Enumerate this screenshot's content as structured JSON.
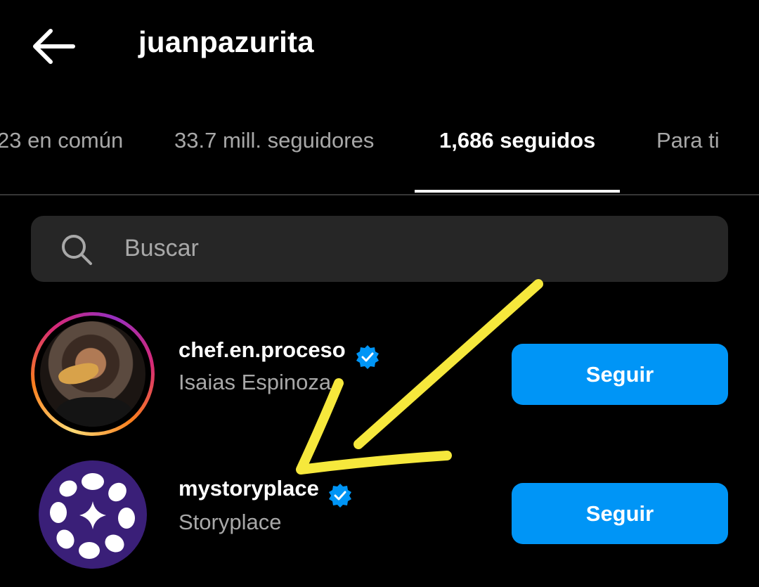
{
  "header": {
    "title": "juanpazurita",
    "back_icon": "arrow-left-icon"
  },
  "tabs": [
    {
      "label": "23 en común",
      "active": false
    },
    {
      "label": "33.7 mill. seguidores",
      "active": false
    },
    {
      "label": "1,686 seguidos",
      "active": true
    },
    {
      "label": "Para ti",
      "active": false
    }
  ],
  "search": {
    "placeholder": "Buscar",
    "value": "",
    "icon": "search-icon"
  },
  "users": [
    {
      "username": "chef.en.proceso",
      "full_name": "Isaias Espinoza",
      "verified": true,
      "has_story": true,
      "button_label": "Seguir"
    },
    {
      "username": "mystoryplace",
      "full_name": "Storyplace",
      "verified": true,
      "has_story": false,
      "button_label": "Seguir"
    }
  ],
  "colors": {
    "background": "#000000",
    "primary_text": "#ffffff",
    "secondary_text": "#a8a8a8",
    "search_bg": "#262626",
    "follow_button": "#0095f6",
    "verified_badge": "#0095f6",
    "annotation_arrow": "#f6e83c",
    "storyplace_avatar": "#3a1f78"
  }
}
